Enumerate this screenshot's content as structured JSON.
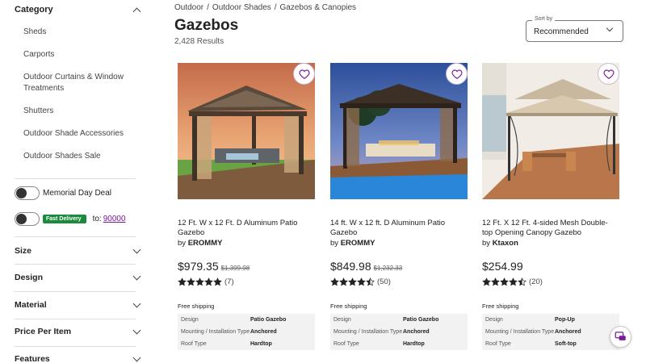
{
  "sidebar": {
    "category_title": "Category",
    "categories": [
      "Sheds",
      "Carports",
      "Outdoor Curtains & Window Treatments",
      "Shutters",
      "Outdoor Shade Accessories",
      "Outdoor Shades Sale"
    ],
    "memorial_toggle": "Memorial Day Deal",
    "fast_delivery_badge": "Fast Delivery",
    "zip_prefix": "to:",
    "zip_code": "90000",
    "facets": [
      "Size",
      "Design",
      "Material",
      "Price Per Item",
      "Features"
    ]
  },
  "breadcrumb": [
    "Outdoor",
    "Outdoor Shades",
    "Gazebos & Canopies"
  ],
  "breadcrumb_sep": "/",
  "page_title": "Gazebos",
  "results": "2,428 Results",
  "sort": {
    "label": "Sort by",
    "value": "Recommended"
  },
  "products": [
    {
      "name": "12 Ft. W x 12 Ft. D Aluminum Patio Gazebo",
      "by": "by",
      "brand": "EROMMY",
      "price": "$979.35",
      "was": "$1,399.98",
      "rating": 5,
      "reviews": "(7)",
      "shipping": "Free shipping",
      "specs": [
        {
          "k": "Design",
          "v": "Patio Gazebo"
        },
        {
          "k": "Mounting / Installation Type",
          "v": "Anchored"
        },
        {
          "k": "Roof Type",
          "v": "Hardtop"
        }
      ]
    },
    {
      "name": "14 ft. W x 12 ft. D Aluminum Patio Gazebo",
      "by": "by",
      "brand": "EROMMY",
      "price": "$849.98",
      "was": "$1,232.33",
      "rating": 4.5,
      "reviews": "(50)",
      "shipping": "Free shipping",
      "specs": [
        {
          "k": "Design",
          "v": "Patio Gazebo"
        },
        {
          "k": "Mounting / Installation Type",
          "v": "Anchored"
        },
        {
          "k": "Roof Type",
          "v": "Hardtop"
        }
      ]
    },
    {
      "name": "12 Ft. X 12 Ft. 4-sided Mesh Double-top Opening Canopy Gazebo",
      "by": "by",
      "brand": "Ktaxon",
      "price": "$254.99",
      "was": "",
      "rating": 4.5,
      "reviews": "(20)",
      "shipping": "Free shipping",
      "specs": [
        {
          "k": "Design",
          "v": "Pop-Up"
        },
        {
          "k": "Mounting / Installation Type",
          "v": "Anchored"
        },
        {
          "k": "Roof Type",
          "v": "Soft-top"
        }
      ]
    }
  ],
  "colors": {
    "accent": "#7b189f",
    "fast_delivery": "#1c8a3c"
  },
  "icons": [
    "chevron-up-icon",
    "chevron-down-icon",
    "heart-icon",
    "star-icon",
    "chat-icon"
  ]
}
